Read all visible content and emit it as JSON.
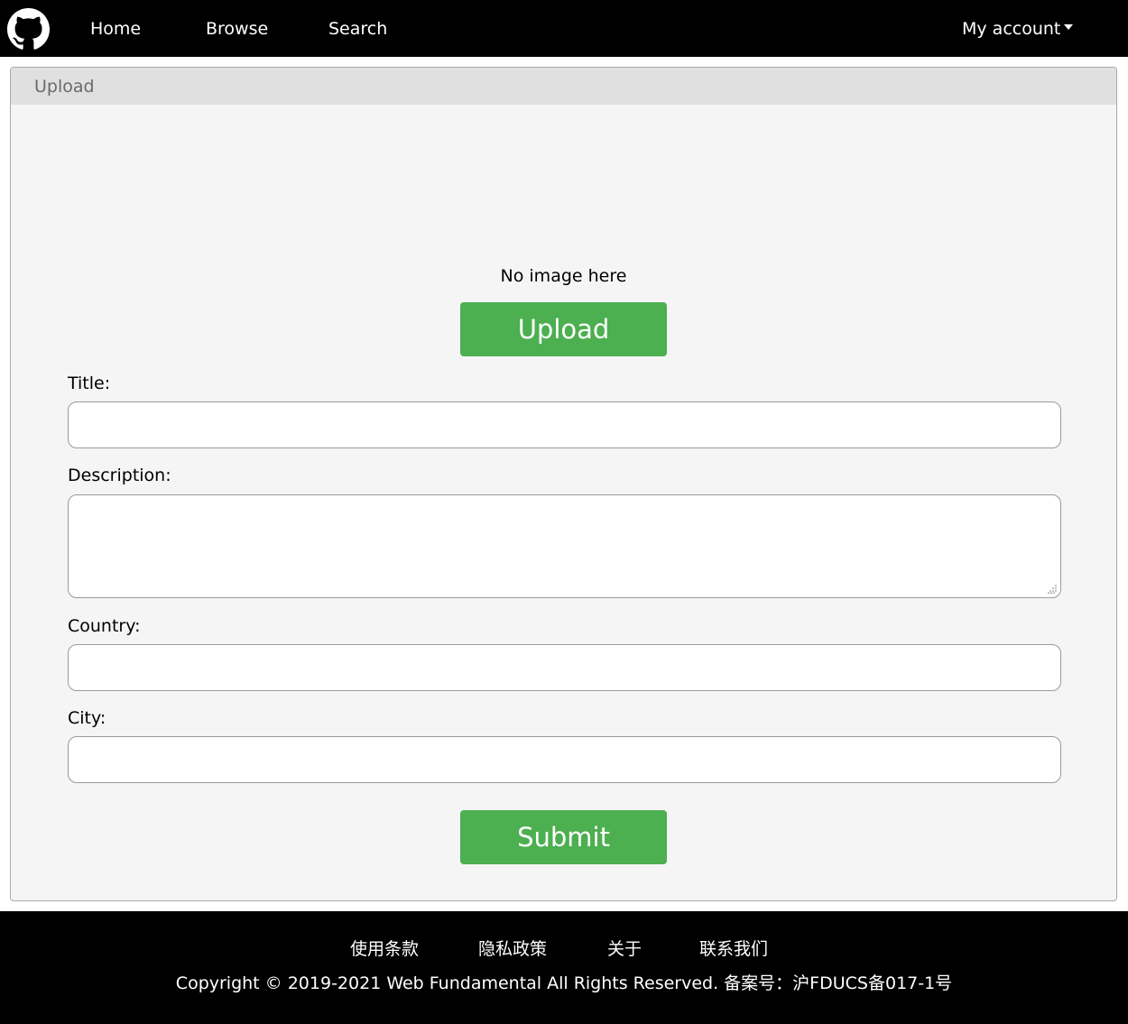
{
  "navbar": {
    "logo_icon": "github-icon",
    "links": [
      "Home",
      "Browse",
      "Search"
    ],
    "account_label": "My account",
    "account_icon": "caret-down-icon"
  },
  "panel": {
    "header": "Upload",
    "no_image_text": "No image here",
    "upload_button": "Upload",
    "fields": {
      "title_label": "Title:",
      "title_value": "",
      "description_label": "Description:",
      "description_value": "",
      "country_label": "Country:",
      "country_value": "",
      "city_label": "City:",
      "city_value": ""
    },
    "submit_button": "Submit"
  },
  "footer": {
    "links": [
      "使用条款",
      "隐私政策",
      "关于",
      "联系我们"
    ],
    "copyright": "Copyright © 2019-2021 Web Fundamental All Rights Reserved. 备案号：沪FDUCS备017-1号"
  },
  "colors": {
    "navbar_bg": "#000000",
    "accent_green": "#4caf50",
    "panel_bg": "#f5f5f5",
    "panel_header_bg": "#e0e0e0"
  }
}
